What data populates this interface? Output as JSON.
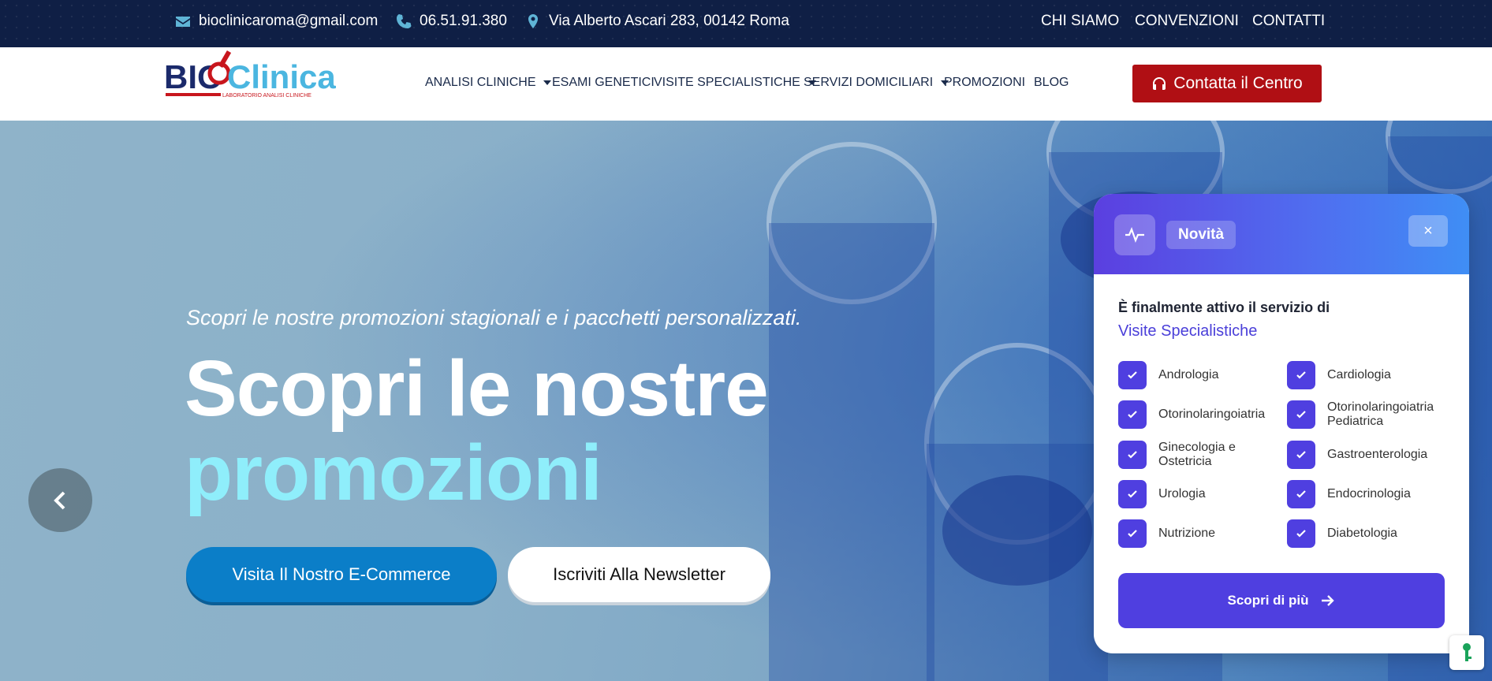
{
  "topbar": {
    "email": "bioclinicaroma@gmail.com",
    "phone": "06.51.91.380",
    "address": "Via Alberto Ascari 283, 00142 Roma",
    "links": [
      "CHI SIAMO",
      "CONVENZIONI",
      "CONTATTI"
    ]
  },
  "logo": {
    "name": "BIOClinica",
    "tagline": "LABORATORIO ANALISI CLINICHE"
  },
  "menu": [
    "ANALISI CLINICHE",
    "ESAMI GENETICI",
    "VISITE SPECIALISTICHE",
    "SERVIZI DOMICILIARI",
    "PROMOZIONI",
    "BLOG"
  ],
  "cta_label": "Contatta il Centro",
  "hero": {
    "subtitle": "Scopri le nostre promozioni stagionali e i pacchetti personalizzati.",
    "title_line1": "Scopri le nostre",
    "title_line2": "promozioni",
    "button_primary": "Visita Il Nostro E-Commerce",
    "button_secondary": "Iscriviti Alla Newsletter"
  },
  "popup": {
    "badge": "Novità",
    "close": "×",
    "intro": "È finalmente attivo il servizio di",
    "intro_highlight": "Visite Specialistiche",
    "specialties": [
      "Andrologia",
      "Cardiologia",
      "Otorinolaringoiatria",
      "Otorinolaringoiatria Pediatrica",
      "Ginecologia e Ostetricia",
      "Gastroenterologia",
      "Urologia",
      "Endocrinologia",
      "Nutrizione",
      "Diabetologia"
    ],
    "button": "Scopri di più"
  },
  "colors": {
    "accent": "#4f3fe0",
    "cta": "#b00f14",
    "topbar": "#0f1f45",
    "hero_highlight": "#8feefb"
  }
}
